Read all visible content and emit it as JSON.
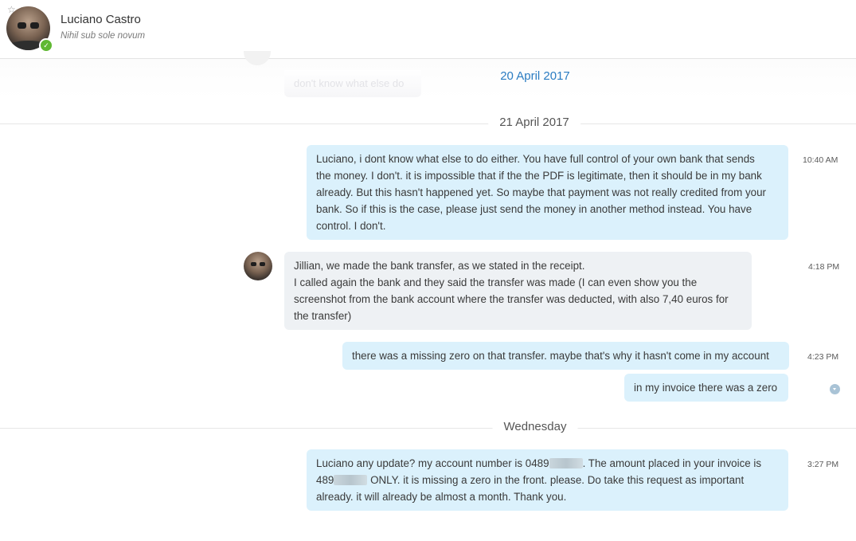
{
  "header": {
    "contact_name": "Luciano Castro",
    "mood": "Nihil sub sole novum",
    "status": "online"
  },
  "ghost": {
    "text": "don't know what else do"
  },
  "days": [
    {
      "label": "20 April 2017"
    },
    {
      "label": "21 April 2017"
    },
    {
      "label": "Wednesday"
    }
  ],
  "messages": [
    {
      "direction": "outgoing",
      "time": "10:40 AM",
      "text": "Luciano, i dont know what else to do either. You have full control of your own bank that sends\nthe money. I don't. it is impossible that if the the PDF is legitimate, then it should be in my bank\nalready. But this hasn't happened yet. So maybe that payment was not really credited from your\nbank. So if this is the case, please just send the money in another method instead. You have\ncontrol. I don't."
    },
    {
      "direction": "incoming",
      "time": "4:18 PM",
      "text": "Jillian, we made the bank transfer, as we stated in the receipt.\nI called again the bank and they said the transfer was made (I can even show you the\nscreenshot from the bank account where the transfer was deducted, with also 7,40 euros for\nthe transfer)"
    },
    {
      "direction": "outgoing",
      "time": "4:23 PM",
      "text": "there was a missing zero on that transfer. maybe that's why it hasn't come in my account"
    },
    {
      "direction": "outgoing",
      "time": "",
      "text": "in my invoice there was a zero"
    },
    {
      "direction": "outgoing",
      "time": "3:27 PM",
      "text_parts": [
        "Luciano any update? my account number is 0489",
        ". The amount placed in your invoice is\n489",
        " ONLY. it is missing a zero in the front. please. Do take this request as important\nalready. it will already be almost a month. Thank you."
      ]
    }
  ],
  "colors": {
    "outgoing_bubble": "#dbf1fc",
    "incoming_bubble": "#eef1f4",
    "sticky_date": "#2a7cc2",
    "online_badge": "#5fb832"
  }
}
